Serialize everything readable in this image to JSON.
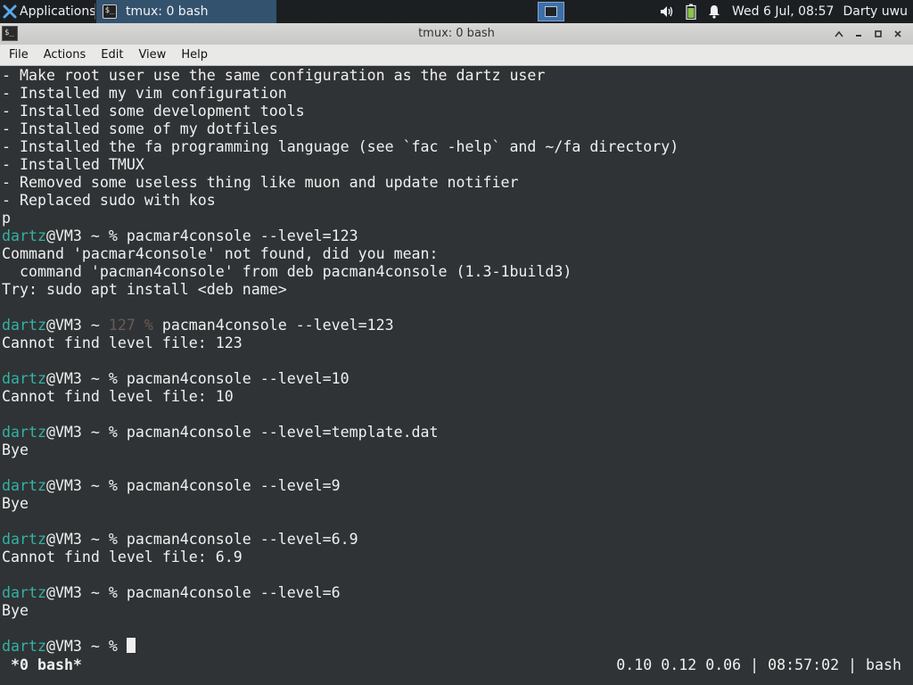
{
  "panel": {
    "apps_label": "Applications",
    "task_label": "tmux: 0 bash",
    "clock": "Wed  6 Jul, 08:57",
    "user": "Darty uwu",
    "icons": [
      "xfce-logo-icon",
      "terminal-icon",
      "workspace-icon",
      "volume-icon",
      "battery-icon",
      "notification-bell-icon"
    ]
  },
  "window": {
    "title": "tmux: 0 bash",
    "menu": [
      "File",
      "Actions",
      "Edit",
      "View",
      "Help"
    ]
  },
  "terminal": {
    "lines": [
      {
        "parts": [
          {
            "t": "- Make root user use the same configuration as the dartz user",
            "c": ""
          }
        ]
      },
      {
        "parts": [
          {
            "t": "- Installed my vim configuration",
            "c": ""
          }
        ]
      },
      {
        "parts": [
          {
            "t": "- Installed some development tools",
            "c": ""
          }
        ]
      },
      {
        "parts": [
          {
            "t": "- Installed some of my dotfiles",
            "c": ""
          }
        ]
      },
      {
        "parts": [
          {
            "t": "- Installed the fa programming language (see `fac -help` and ~/fa directory)",
            "c": ""
          }
        ]
      },
      {
        "parts": [
          {
            "t": "- Installed TMUX",
            "c": ""
          }
        ]
      },
      {
        "parts": [
          {
            "t": "- Removed some useless thing like muon and update notifier",
            "c": ""
          }
        ]
      },
      {
        "parts": [
          {
            "t": "- Replaced sudo with kos",
            "c": ""
          }
        ]
      },
      {
        "parts": [
          {
            "t": "p",
            "c": ""
          }
        ]
      },
      {
        "parts": [
          {
            "t": "dartz",
            "c": "c-user"
          },
          {
            "t": "@VM3 ~ % pacmar4console --level=123",
            "c": ""
          }
        ]
      },
      {
        "parts": [
          {
            "t": "Command 'pacmar4console' not found, did you mean:",
            "c": ""
          }
        ]
      },
      {
        "parts": [
          {
            "t": "  command 'pacman4console' from deb pacman4console (1.3-1build3)",
            "c": ""
          }
        ]
      },
      {
        "parts": [
          {
            "t": "Try: sudo apt install <deb name>",
            "c": ""
          }
        ]
      },
      {
        "parts": [
          {
            "t": "",
            "c": ""
          }
        ]
      },
      {
        "parts": [
          {
            "t": "dartz",
            "c": "c-user"
          },
          {
            "t": "@VM3 ~ ",
            "c": ""
          },
          {
            "t": "127 %",
            "c": "c-dim"
          },
          {
            "t": " pacman4console --level=123",
            "c": ""
          }
        ]
      },
      {
        "parts": [
          {
            "t": "Cannot find level file: 123",
            "c": ""
          }
        ]
      },
      {
        "parts": [
          {
            "t": "",
            "c": ""
          }
        ]
      },
      {
        "parts": [
          {
            "t": "dartz",
            "c": "c-user"
          },
          {
            "t": "@VM3 ~ % pacman4console --level=10",
            "c": ""
          }
        ]
      },
      {
        "parts": [
          {
            "t": "Cannot find level file: 10",
            "c": ""
          }
        ]
      },
      {
        "parts": [
          {
            "t": "",
            "c": ""
          }
        ]
      },
      {
        "parts": [
          {
            "t": "dartz",
            "c": "c-user"
          },
          {
            "t": "@VM3 ~ % pacman4console --level=template.dat",
            "c": ""
          }
        ]
      },
      {
        "parts": [
          {
            "t": "Bye",
            "c": ""
          }
        ]
      },
      {
        "parts": [
          {
            "t": "",
            "c": ""
          }
        ]
      },
      {
        "parts": [
          {
            "t": "dartz",
            "c": "c-user"
          },
          {
            "t": "@VM3 ~ % pacman4console --level=9",
            "c": ""
          }
        ]
      },
      {
        "parts": [
          {
            "t": "Bye",
            "c": ""
          }
        ]
      },
      {
        "parts": [
          {
            "t": "",
            "c": ""
          }
        ]
      },
      {
        "parts": [
          {
            "t": "dartz",
            "c": "c-user"
          },
          {
            "t": "@VM3 ~ % pacman4console --level=6.9",
            "c": ""
          }
        ]
      },
      {
        "parts": [
          {
            "t": "Cannot find level file: 6.9",
            "c": ""
          }
        ]
      },
      {
        "parts": [
          {
            "t": "",
            "c": ""
          }
        ]
      },
      {
        "parts": [
          {
            "t": "dartz",
            "c": "c-user"
          },
          {
            "t": "@VM3 ~ % pacman4console --level=6",
            "c": ""
          }
        ]
      },
      {
        "parts": [
          {
            "t": "Bye",
            "c": ""
          }
        ]
      },
      {
        "parts": [
          {
            "t": "",
            "c": ""
          }
        ]
      },
      {
        "parts": [
          {
            "t": "dartz",
            "c": "c-user"
          },
          {
            "t": "@VM3 ~ % ",
            "c": ""
          }
        ],
        "cursor": true
      }
    ],
    "status_left": "*0 bash*",
    "status_right": "0.10 0.12 0.06 | 08:57:02 | bash"
  },
  "colors": {
    "terminal_bg": "#2f3335",
    "prompt_user": "#34b1a4",
    "exit_code": "#6a5b55",
    "panel_bg": "#1c1f22",
    "task_active": "#33526e"
  }
}
